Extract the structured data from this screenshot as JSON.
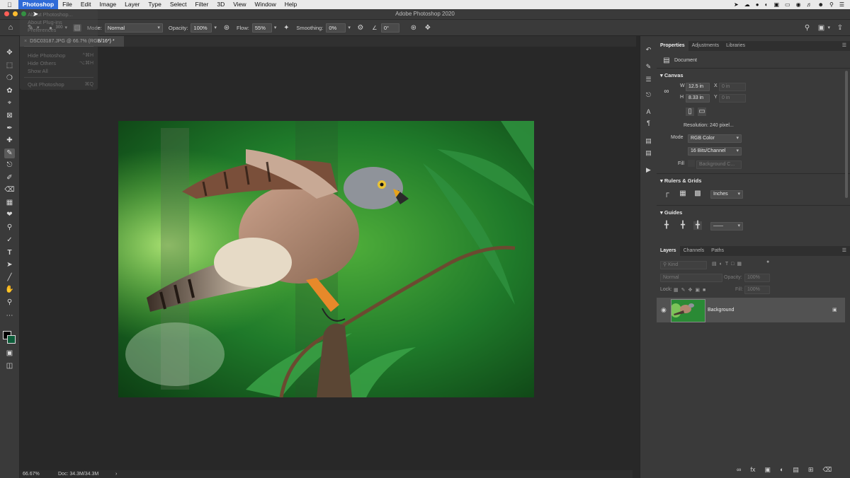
{
  "menubar": {
    "apple": "",
    "items": [
      "Photoshop",
      "File",
      "Edit",
      "Image",
      "Layer",
      "Type",
      "Select",
      "Filter",
      "3D",
      "View",
      "Window",
      "Help"
    ]
  },
  "window": {
    "title": "Adobe Photoshop 2020"
  },
  "options": {
    "mode_label": "Mode:",
    "mode_value": "Normal",
    "brush_size": "300",
    "opacity_label": "Opacity:",
    "opacity_value": "100%",
    "flow_label": "Flow:",
    "flow_value": "55%",
    "smoothing_label": "Smoothing:",
    "smoothing_value": "0%",
    "angle_value": "0°"
  },
  "doctab": {
    "label": "DSC03187.JPG @ 66.7% (RGB/16*) *"
  },
  "ps_menu": {
    "items": [
      {
        "label": "About Photoshop...",
        "key": ""
      },
      {
        "label": "About Plug-ins",
        "key": ""
      },
      {
        "label": "Preferences",
        "key": ""
      },
      {
        "label": "Hide Photoshop",
        "key": "^⌘H"
      },
      {
        "label": "Hide Others",
        "key": "⌥⌘H"
      },
      {
        "label": "Show All",
        "key": ""
      },
      {
        "label": "Quit Photoshop",
        "key": "⌘Q"
      }
    ]
  },
  "status": {
    "zoom": "66.67%",
    "doc": "Doc: 34.3M/34.3M",
    "arrow": "›"
  },
  "properties": {
    "tabs": [
      "Properties",
      "Adjustments",
      "Libraries"
    ],
    "doc_label": "Document",
    "canvas_title": "Canvas",
    "w_label": "W",
    "w_value": "12.5 in",
    "h_label": "H",
    "h_value": "8.33 in",
    "x_label": "X",
    "x_value": "0 in",
    "y_label": "Y",
    "y_value": "0 in",
    "resolution": "Resolution: 240 pixel...",
    "mode_label": "Mode",
    "mode_value": "RGB Color",
    "bits_value": "16 Bits/Channel",
    "fill_label": "Fill",
    "fill_value": "Background C...",
    "rulers_title": "Rulers & Grids",
    "units_value": "Inches",
    "guides_title": "Guides"
  },
  "layers": {
    "tabs": [
      "Layers",
      "Channels",
      "Paths"
    ],
    "kind_placeholder": "Kind",
    "blend_value": "Normal",
    "opacity_label": "Opacity:",
    "opacity_value": "100%",
    "lock_label": "Lock:",
    "fill_label": "Fill:",
    "fill_value": "100%",
    "layer_name": "Background"
  }
}
